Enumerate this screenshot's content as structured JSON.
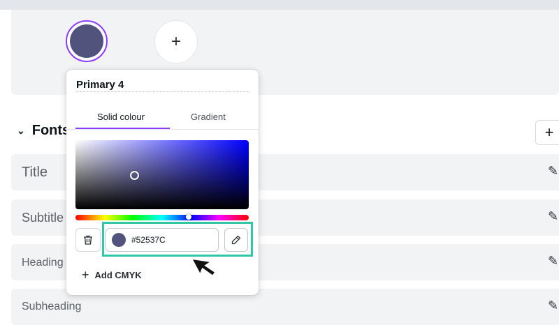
{
  "colors_section": {
    "primary_swatch_color": "#52537C",
    "add_color_icon": "plus-icon"
  },
  "fonts_section": {
    "heading": "Fonts",
    "rows": [
      {
        "label": "Title"
      },
      {
        "label": "Subtitle"
      },
      {
        "label": "Heading"
      },
      {
        "label": "Subheading"
      }
    ]
  },
  "color_popup": {
    "title": "Primary 4",
    "tabs": [
      {
        "label": "Solid colour",
        "active": true
      },
      {
        "label": "Gradient",
        "active": false
      }
    ],
    "hex_value": "#52537C",
    "add_cmyk_label": "Add CMYK",
    "accent": "#8b3dff",
    "highlight_color": "#32c6a8"
  }
}
